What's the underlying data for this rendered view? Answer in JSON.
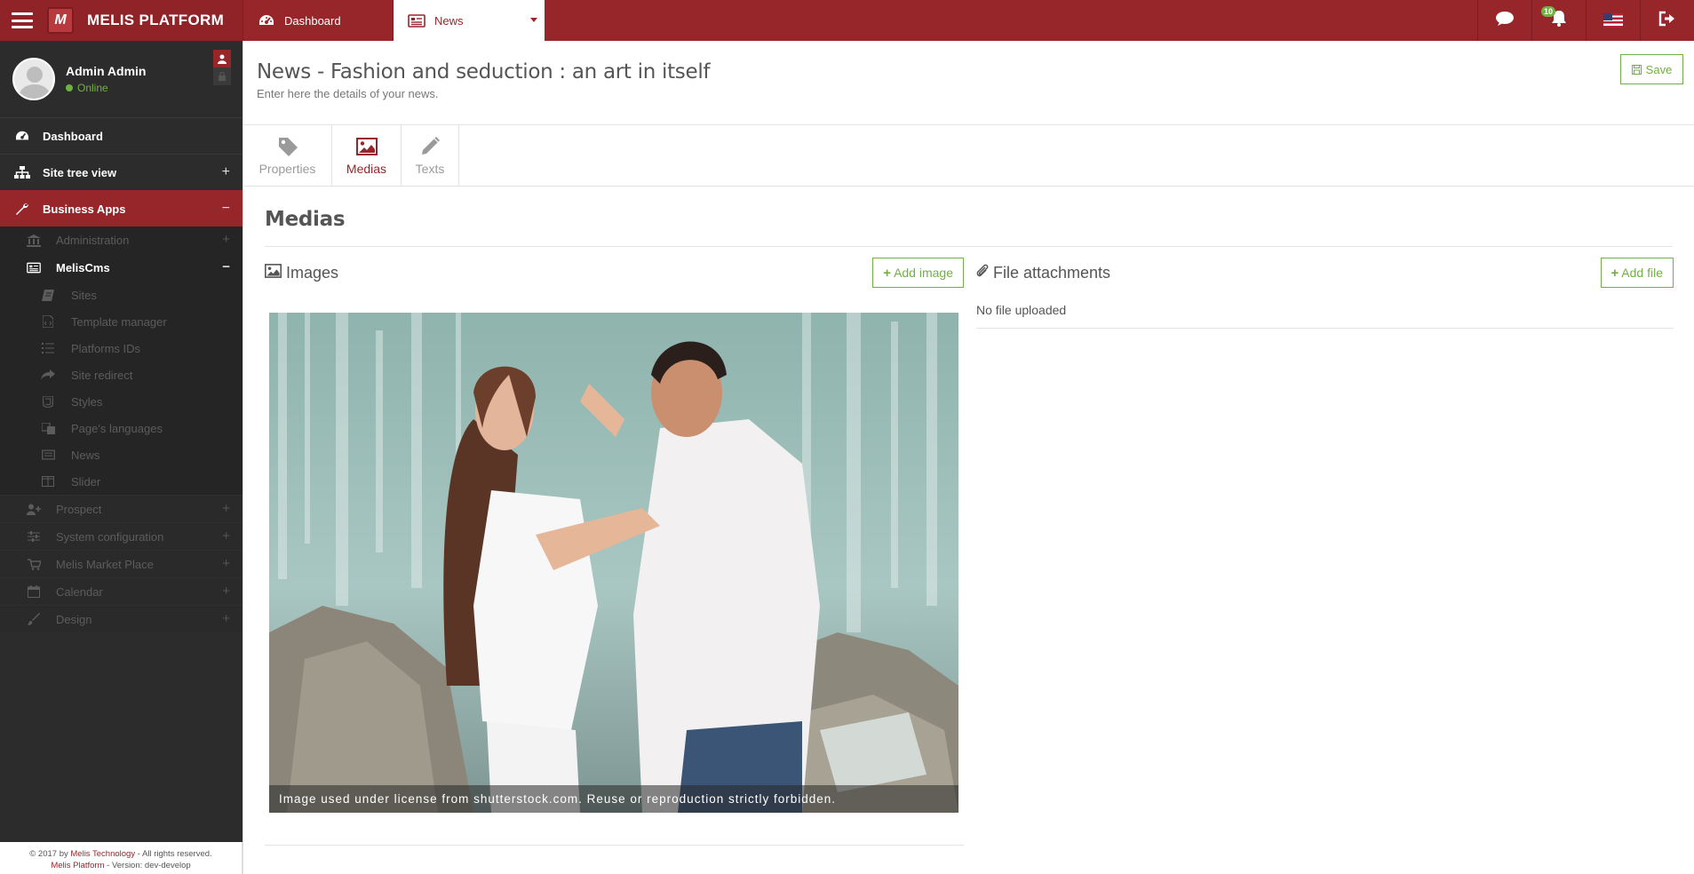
{
  "app": {
    "brand": "MELIS PLATFORM",
    "logo_letter": "M",
    "tabs": [
      {
        "label": "Dashboard"
      },
      {
        "label": "News"
      }
    ],
    "notifications_count": "10"
  },
  "sidebar": {
    "user_name": "Admin Admin",
    "user_status": "Online",
    "nav": {
      "dashboard": "Dashboard",
      "site_tree": "Site tree view",
      "business_apps": "Business Apps"
    },
    "business": {
      "administration": "Administration",
      "meliscms": "MelisCms",
      "cms_items": [
        "Sites",
        "Template manager",
        "Platforms IDs",
        "Site redirect",
        "Styles",
        "Page's languages",
        "News",
        "Slider"
      ],
      "lower_items": [
        "Prospect",
        "System configuration",
        "Melis Market Place",
        "Calendar",
        "Design"
      ]
    },
    "footer": {
      "line1_prefix": "© 2017 by ",
      "line1_company": "Melis Technology",
      "line1_suffix": " - All rights reserved.",
      "line2_product": "Melis Platform",
      "line2_suffix": " - Version: dev-develop"
    }
  },
  "page": {
    "title": "News - Fashion and seduction : an art in itself",
    "subtitle": "Enter here the details of your news.",
    "save_label": "Save",
    "subtabs": [
      "Properties",
      "Medias",
      "Texts"
    ],
    "section_title": "Medias",
    "images": {
      "title": "Images",
      "add_label": "Add image",
      "caption": "Image used under license from shutterstock.com. Reuse or reproduction strictly forbidden."
    },
    "files": {
      "title": "File attachments",
      "add_label": "Add file",
      "empty": "No file uploaded"
    }
  },
  "colors": {
    "brand_red": "#97262b",
    "success_green": "#72af46",
    "sidebar_dark": "#2c2c2c"
  }
}
